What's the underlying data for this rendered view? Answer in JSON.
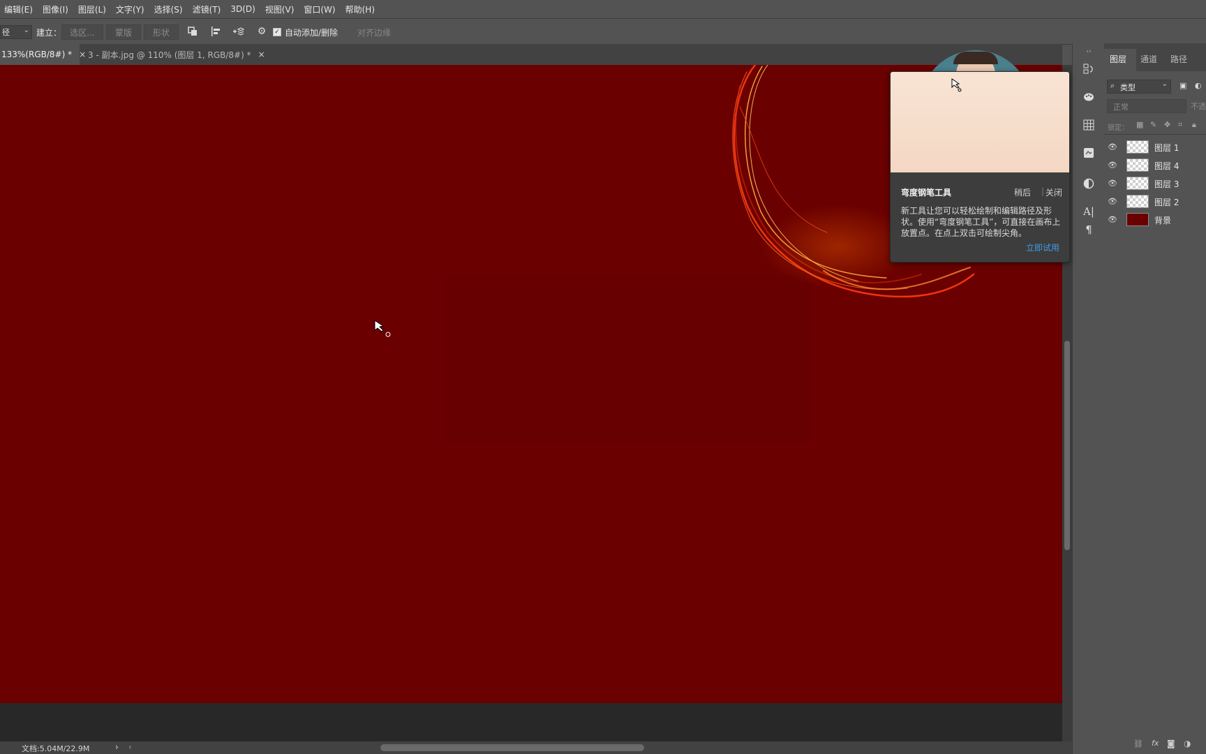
{
  "menu": [
    "编辑(E)",
    "图像(I)",
    "图层(L)",
    "文字(Y)",
    "选择(S)",
    "滤镜(T)",
    "3D(D)",
    "视图(V)",
    "窗口(W)",
    "帮助(H)"
  ],
  "options_bar": {
    "mode_value": "径",
    "build_label": "建立：",
    "selection_btn": "选区...",
    "mask_btn": "蒙版",
    "shape_btn": "形状",
    "auto_add_delete": "自动添加/删除",
    "align_edges": "对齐边缘"
  },
  "tabs": [
    {
      "label": "133%(RGB/8#) *",
      "close": "×"
    },
    {
      "label": "3 - 副本.jpg @ 110% (图层 1, RGB/8#) *",
      "close": "×"
    }
  ],
  "status": {
    "doc_info": "文档:5.04M/22.9M",
    "arrow": "›",
    "left_arrow": "‹"
  },
  "tooltip": {
    "title": "弯度钢笔工具",
    "later": "稍后",
    "close": "关闭",
    "separator": "|",
    "body": "新工具让您可以轻松绘制和编辑路径及形状。使用“弯度钢笔工具”，可直接在画布上放置点。在点上双击可绘制尖角。",
    "try_now": "立即试用"
  },
  "layers_panel": {
    "tabs": [
      "图层",
      "通道",
      "路径"
    ],
    "filter_label": "类型",
    "blend_mode": "正常",
    "opacity_label": "不透",
    "lock_label": "锁定：",
    "layers": [
      {
        "name": "图层 1",
        "visible": true,
        "thumb": "transparent"
      },
      {
        "name": "图层 4",
        "visible": true,
        "thumb": "transparent"
      },
      {
        "name": "图层 3",
        "visible": true,
        "thumb": "transparent"
      },
      {
        "name": "图层 2",
        "visible": true,
        "thumb": "transparent"
      },
      {
        "name": "背景",
        "visible": true,
        "thumb": "solid"
      }
    ],
    "footer_icons": [
      "link-icon",
      "fx-icon",
      "mask-icon",
      "adjustment-icon"
    ],
    "fx_text": "fx"
  },
  "toolstrip_icons": [
    "history-icon",
    "color-palette-icon",
    "grid-swatch-icon",
    "libraries-icon",
    "adjustments-icon",
    "character-icon",
    "paragraph-icon"
  ],
  "colors": {
    "canvas": "#6a0000",
    "ui_bg": "#535353",
    "link": "#3f9be9"
  }
}
